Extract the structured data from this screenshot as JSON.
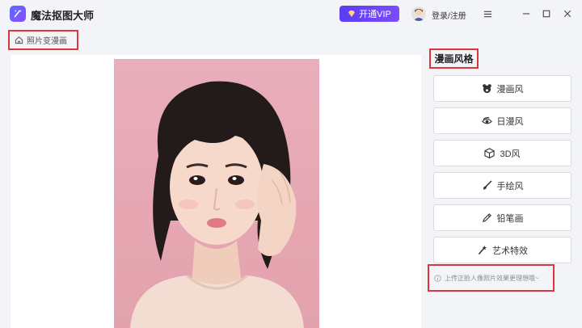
{
  "app": {
    "title": "魔法抠图大师"
  },
  "header": {
    "vip_label": "开通VIP",
    "login_label": "登录/注册"
  },
  "breadcrumb": {
    "label": "照片变漫画"
  },
  "panel": {
    "title": "漫画风格",
    "styles": [
      {
        "label": "漫画风",
        "icon": "bear-icon"
      },
      {
        "label": "日漫风",
        "icon": "eye-swirl-icon"
      },
      {
        "label": "3D风",
        "icon": "cube-icon"
      },
      {
        "label": "手绘风",
        "icon": "brush-icon"
      },
      {
        "label": "铅笔画",
        "icon": "pencil-icon"
      },
      {
        "label": "艺术特效",
        "icon": "magic-wand-icon"
      }
    ],
    "hint": "上传正脸人像照片效果更理想哦~"
  },
  "colors": {
    "accent": "#6a45f7",
    "highlight_border": "#d9363e",
    "photo_bg": "#e8abb8"
  }
}
